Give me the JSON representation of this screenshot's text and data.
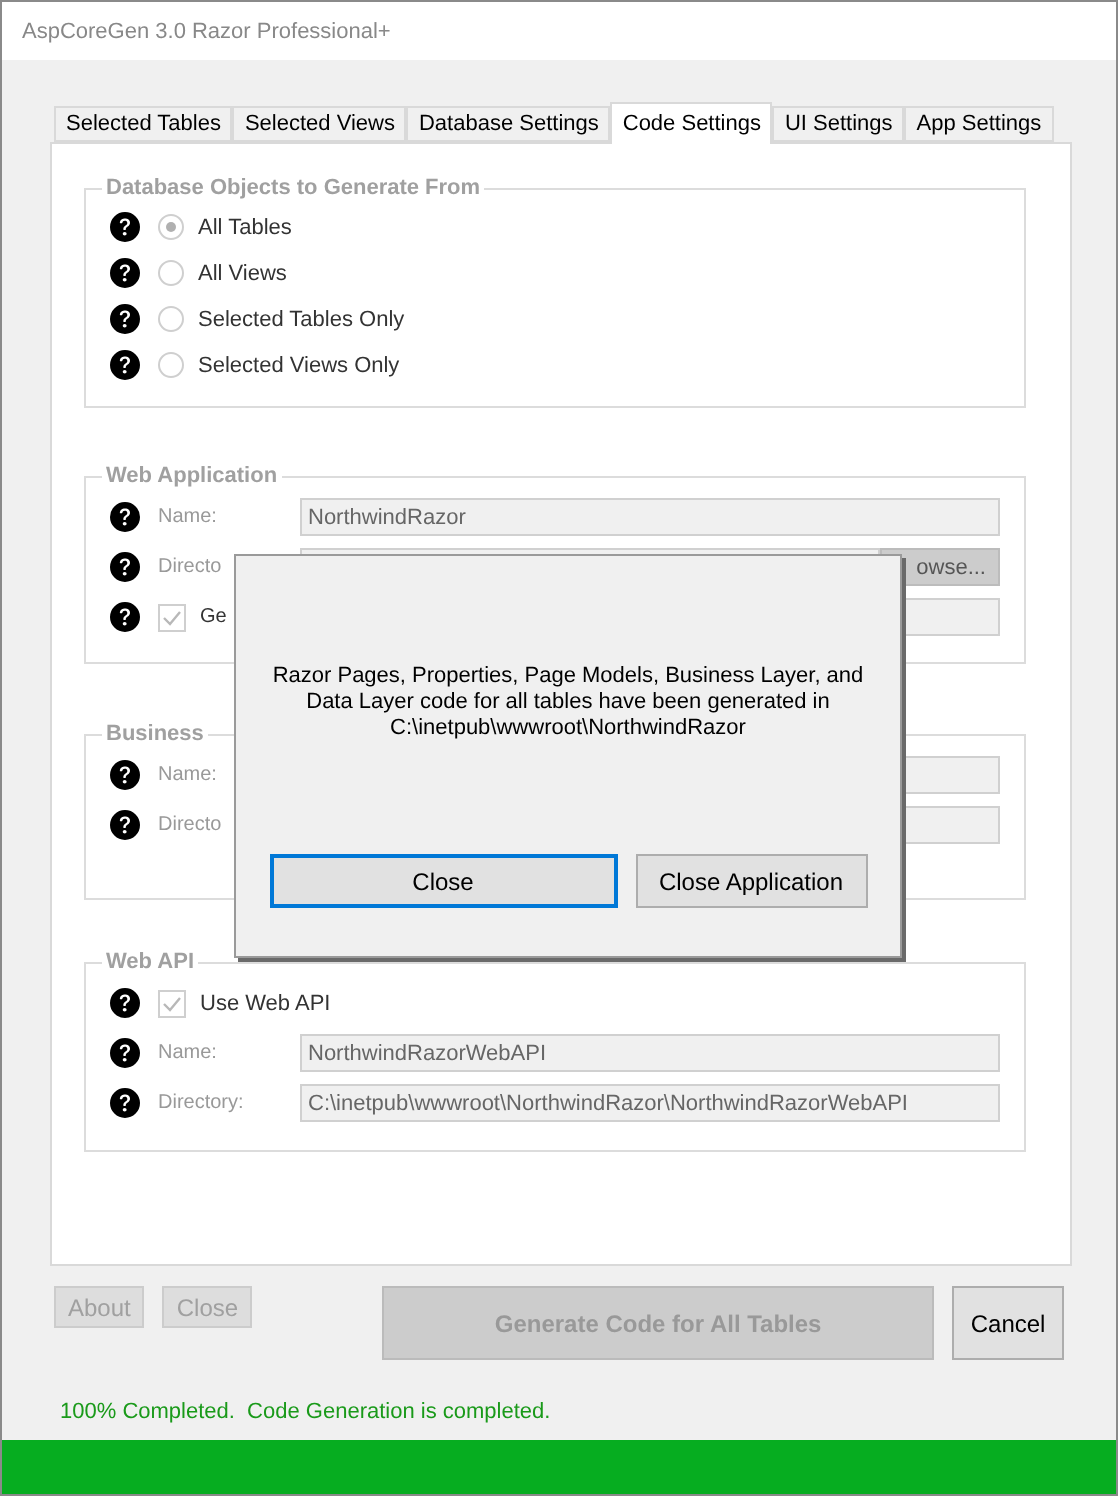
{
  "window": {
    "title": "AspCoreGen 3.0 Razor Professional+"
  },
  "tabs": [
    {
      "label": "Selected Tables",
      "selected": false
    },
    {
      "label": "Selected Views",
      "selected": false
    },
    {
      "label": "Database Settings",
      "selected": false
    },
    {
      "label": "Code Settings",
      "selected": true
    },
    {
      "label": "UI Settings",
      "selected": false
    },
    {
      "label": "App Settings",
      "selected": false
    }
  ],
  "groups": [
    {
      "title": "Database Objects to Generate From",
      "rows": [
        {
          "kind": "radio",
          "label": "All Tables",
          "selected": true
        },
        {
          "kind": "radio",
          "label": "All Views",
          "selected": false
        },
        {
          "kind": "radio",
          "label": "Selected Tables Only",
          "selected": false
        },
        {
          "kind": "radio",
          "label": "Selected Views Only",
          "selected": false
        }
      ]
    },
    {
      "title": "Web Application",
      "rows": [
        {
          "kind": "field",
          "label": "Name:",
          "value": "NorthwindRazor"
        },
        {
          "kind": "browse",
          "label": "Directo",
          "button": "owse..."
        },
        {
          "kind": "checkfield",
          "label": "Ge",
          "checked": true
        }
      ]
    },
    {
      "title": "Business",
      "rows": [
        {
          "kind": "field",
          "label": "Name:"
        },
        {
          "kind": "field",
          "label": "Directo"
        }
      ]
    },
    {
      "title": "Web API",
      "rows": [
        {
          "kind": "checkbox",
          "label": "Use Web API",
          "checked": true
        },
        {
          "kind": "field",
          "label": "Name:",
          "value": "NorthwindRazorWebAPI"
        },
        {
          "kind": "field",
          "label": "Directory:",
          "value": "C:\\inetpub\\wwwroot\\NorthwindRazor\\NorthwindRazorWebAPI"
        }
      ]
    }
  ],
  "buttons": {
    "about": "About",
    "close": "Close",
    "generate": "Generate Code for All Tables",
    "cancel": "Cancel"
  },
  "status": "100% Completed.  Code Generation is completed.",
  "progress": {
    "level": 1
  },
  "dialog": {
    "message": "Razor Pages, Properties, Page Models, Business Layer, and Data Layer code for all tables have been generated in C:\\inetpub\\wwwroot\\NorthwindRazor",
    "buttons": [
      {
        "label": "Close",
        "selected": true
      },
      {
        "label": "Close Application",
        "selected": false
      }
    ]
  }
}
